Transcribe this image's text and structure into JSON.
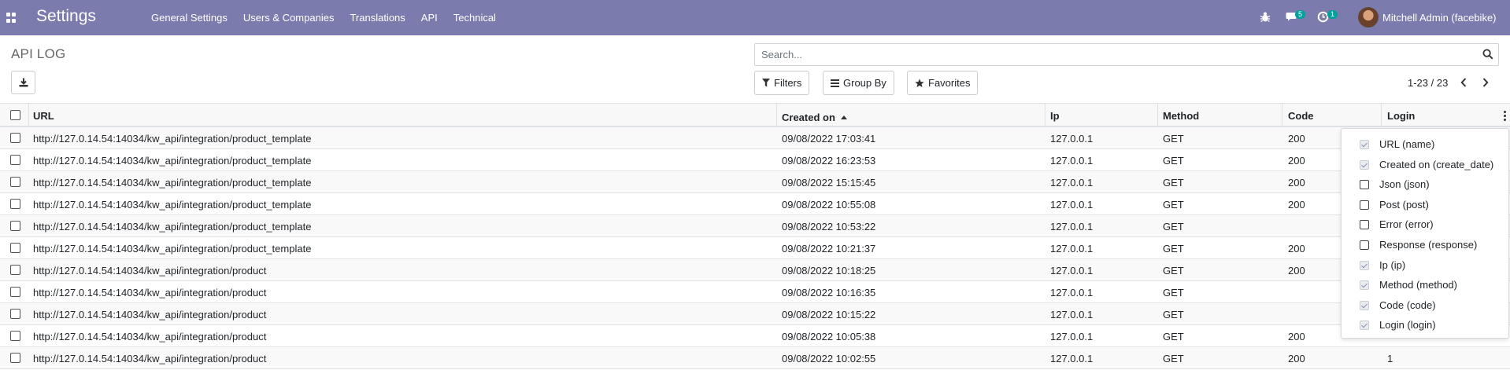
{
  "navbar": {
    "app_title": "Settings",
    "menu": [
      "General Settings",
      "Users & Companies",
      "Translations",
      "API",
      "Technical"
    ],
    "messages_count": "5",
    "activities_count": "1",
    "user_name": "Mitchell Admin (facebike)",
    "color": "#7c7bad"
  },
  "control_panel": {
    "title": "API LOG",
    "search_placeholder": "Search...",
    "filters_label": "Filters",
    "group_by_label": "Group By",
    "favorites_label": "Favorites",
    "pager": "1-23 / 23"
  },
  "table": {
    "columns": [
      "URL",
      "Created on",
      "Ip",
      "Method",
      "Code",
      "Login"
    ],
    "sorted_column": "Created on",
    "sort_direction": "ascending",
    "rows": [
      {
        "url": "http://127.0.14.54:14034/kw_api/integration/product_template",
        "created_on": "09/08/2022 17:03:41",
        "ip": "127.0.0.1",
        "method": "GET",
        "code": "200",
        "login": ""
      },
      {
        "url": "http://127.0.14.54:14034/kw_api/integration/product_template",
        "created_on": "09/08/2022 16:23:53",
        "ip": "127.0.0.1",
        "method": "GET",
        "code": "200",
        "login": ""
      },
      {
        "url": "http://127.0.14.54:14034/kw_api/integration/product_template",
        "created_on": "09/08/2022 15:15:45",
        "ip": "127.0.0.1",
        "method": "GET",
        "code": "200",
        "login": ""
      },
      {
        "url": "http://127.0.14.54:14034/kw_api/integration/product_template",
        "created_on": "09/08/2022 10:55:08",
        "ip": "127.0.0.1",
        "method": "GET",
        "code": "200",
        "login": ""
      },
      {
        "url": "http://127.0.14.54:14034/kw_api/integration/product_template",
        "created_on": "09/08/2022 10:53:22",
        "ip": "127.0.0.1",
        "method": "GET",
        "code": "",
        "login": ""
      },
      {
        "url": "http://127.0.14.54:14034/kw_api/integration/product_template",
        "created_on": "09/08/2022 10:21:37",
        "ip": "127.0.0.1",
        "method": "GET",
        "code": "200",
        "login": ""
      },
      {
        "url": "http://127.0.14.54:14034/kw_api/integration/product",
        "created_on": "09/08/2022 10:18:25",
        "ip": "127.0.0.1",
        "method": "GET",
        "code": "200",
        "login": ""
      },
      {
        "url": "http://127.0.14.54:14034/kw_api/integration/product",
        "created_on": "09/08/2022 10:16:35",
        "ip": "127.0.0.1",
        "method": "GET",
        "code": "",
        "login": ""
      },
      {
        "url": "http://127.0.14.54:14034/kw_api/integration/product",
        "created_on": "09/08/2022 10:15:22",
        "ip": "127.0.0.1",
        "method": "GET",
        "code": "",
        "login": ""
      },
      {
        "url": "http://127.0.14.54:14034/kw_api/integration/product",
        "created_on": "09/08/2022 10:05:38",
        "ip": "127.0.0.1",
        "method": "GET",
        "code": "200",
        "login": ""
      },
      {
        "url": "http://127.0.14.54:14034/kw_api/integration/product",
        "created_on": "09/08/2022 10:02:55",
        "ip": "127.0.0.1",
        "method": "GET",
        "code": "200",
        "login": "1"
      }
    ]
  },
  "optional_columns": [
    {
      "label": "URL (name)",
      "checked": true
    },
    {
      "label": "Created on (create_date)",
      "checked": true
    },
    {
      "label": "Json (json)",
      "checked": false
    },
    {
      "label": "Post (post)",
      "checked": false
    },
    {
      "label": "Error (error)",
      "checked": false
    },
    {
      "label": "Response (response)",
      "checked": false
    },
    {
      "label": "Ip (ip)",
      "checked": true
    },
    {
      "label": "Method (method)",
      "checked": true
    },
    {
      "label": "Code (code)",
      "checked": true
    },
    {
      "label": "Login (login)",
      "checked": true
    }
  ]
}
